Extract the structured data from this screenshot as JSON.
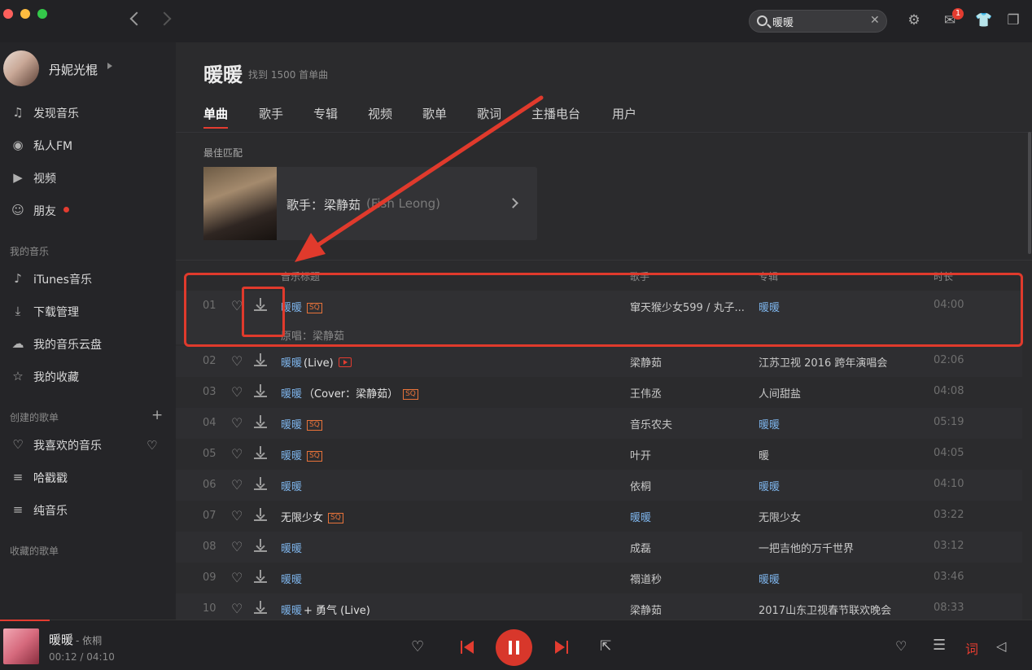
{
  "header": {
    "search": {
      "value": "暖暖",
      "clear_icon": "close-icon"
    },
    "mail_badge": "1",
    "icons": [
      "back-icon",
      "forward-icon",
      "search-icon",
      "settings-icon",
      "mail-icon",
      "skin-icon",
      "mini-player-icon"
    ]
  },
  "user": {
    "name": "丹妮光棍"
  },
  "sidebar": {
    "primary": [
      {
        "label": "发现音乐",
        "icon": "music-note-icon"
      },
      {
        "label": "私人FM",
        "icon": "radio-icon"
      },
      {
        "label": "视频",
        "icon": "video-icon"
      },
      {
        "label": "朋友",
        "icon": "friends-icon"
      }
    ],
    "my_music_title": "我的音乐",
    "my_music": [
      {
        "label": "iTunes音乐",
        "icon": "itunes-icon"
      },
      {
        "label": "下载管理",
        "icon": "download-icon"
      },
      {
        "label": "我的音乐云盘",
        "icon": "cloud-icon"
      },
      {
        "label": "我的收藏",
        "icon": "star-icon"
      }
    ],
    "created_title": "创建的歌单",
    "created": [
      {
        "label": "我喜欢的音乐",
        "icon": "heart-icon"
      },
      {
        "label": "哈戳戳",
        "icon": "playlist-icon"
      },
      {
        "label": "纯音乐",
        "icon": "playlist-icon"
      }
    ],
    "collected_title": "收藏的歌单"
  },
  "main": {
    "search_term": "暖暖",
    "result_count": "找到 1500 首单曲",
    "tabs": [
      "单曲",
      "歌手",
      "专辑",
      "视频",
      "歌单",
      "歌词",
      "主播电台",
      "用户"
    ],
    "active_tab": "单曲",
    "best_match": {
      "title": "最佳匹配",
      "label": "歌手：",
      "name": "梁静茹",
      "name_en": "(Fish Leong)"
    },
    "columns": {
      "title": "音乐标题",
      "artist": "歌手",
      "album": "专辑",
      "duration": "时长"
    },
    "songs": [
      {
        "num": "01",
        "title": "暖暖",
        "title_extra": "",
        "badge": "SQ",
        "subtitle": "原唱：梁静茹",
        "artist": "窜天猴少女599 / 丸子...",
        "album": "暖暖",
        "duration": "04:00"
      },
      {
        "num": "02",
        "title": "暖暖",
        "title_extra": "(Live)",
        "badge": "MV",
        "subtitle": "",
        "artist": "梁静茹",
        "album": "江苏卫视 2016 跨年演唱会",
        "duration": "02:06"
      },
      {
        "num": "03",
        "title": "暖暖",
        "title_extra": "（Cover：梁静茹）",
        "badge": "SQ",
        "subtitle": "",
        "artist": "王伟丞",
        "album": "人间甜盐",
        "duration": "04:08"
      },
      {
        "num": "04",
        "title": "暖暖",
        "title_extra": "",
        "badge": "SQ",
        "subtitle": "",
        "artist": "音乐农夫",
        "album": "暖暖",
        "duration": "05:19"
      },
      {
        "num": "05",
        "title": "暖暖",
        "title_extra": "",
        "badge": "SQ",
        "subtitle": "",
        "artist": "叶开",
        "album": "暖",
        "duration": "04:05"
      },
      {
        "num": "06",
        "title": "暖暖",
        "title_extra": "",
        "badge": "",
        "subtitle": "",
        "artist": "依桐",
        "album": "暖暖",
        "duration": "04:10"
      },
      {
        "num": "07",
        "title": "无限少女",
        "title_extra": "",
        "badge": "SQ",
        "subtitle": "",
        "artist": "暖暖",
        "album": "无限少女",
        "duration": "03:22"
      },
      {
        "num": "08",
        "title": "暖暖",
        "title_extra": "",
        "badge": "",
        "subtitle": "",
        "artist": "成磊",
        "album": "一把吉他的万千世界",
        "duration": "03:12"
      },
      {
        "num": "09",
        "title": "暖暖",
        "title_extra": "",
        "badge": "",
        "subtitle": "",
        "artist": "禤道秒",
        "album": "暖暖",
        "duration": "03:46"
      },
      {
        "num": "10",
        "title": "暖暖",
        "title_extra": "+ 勇气 (Live)",
        "badge": "",
        "subtitle": "",
        "artist": "梁静茹",
        "album": "2017山东卫视春节联欢晚会",
        "duration": "08:33"
      }
    ]
  },
  "player": {
    "title": "暖暖",
    "artist": "- 依桐",
    "time": "00:12 / 04:10",
    "progress": 0.048,
    "lyric_label": "词",
    "icons": [
      "like-icon",
      "previous-icon",
      "pause-icon",
      "next-icon",
      "share-icon",
      "heartbeat-mode-icon",
      "playlist-icon",
      "lyric-icon",
      "volume-icon"
    ]
  },
  "colors": {
    "accent": "#e33c30",
    "link": "#7cb2e8",
    "sq_badge": "#e8733a",
    "annotation": "#e03a2c"
  }
}
